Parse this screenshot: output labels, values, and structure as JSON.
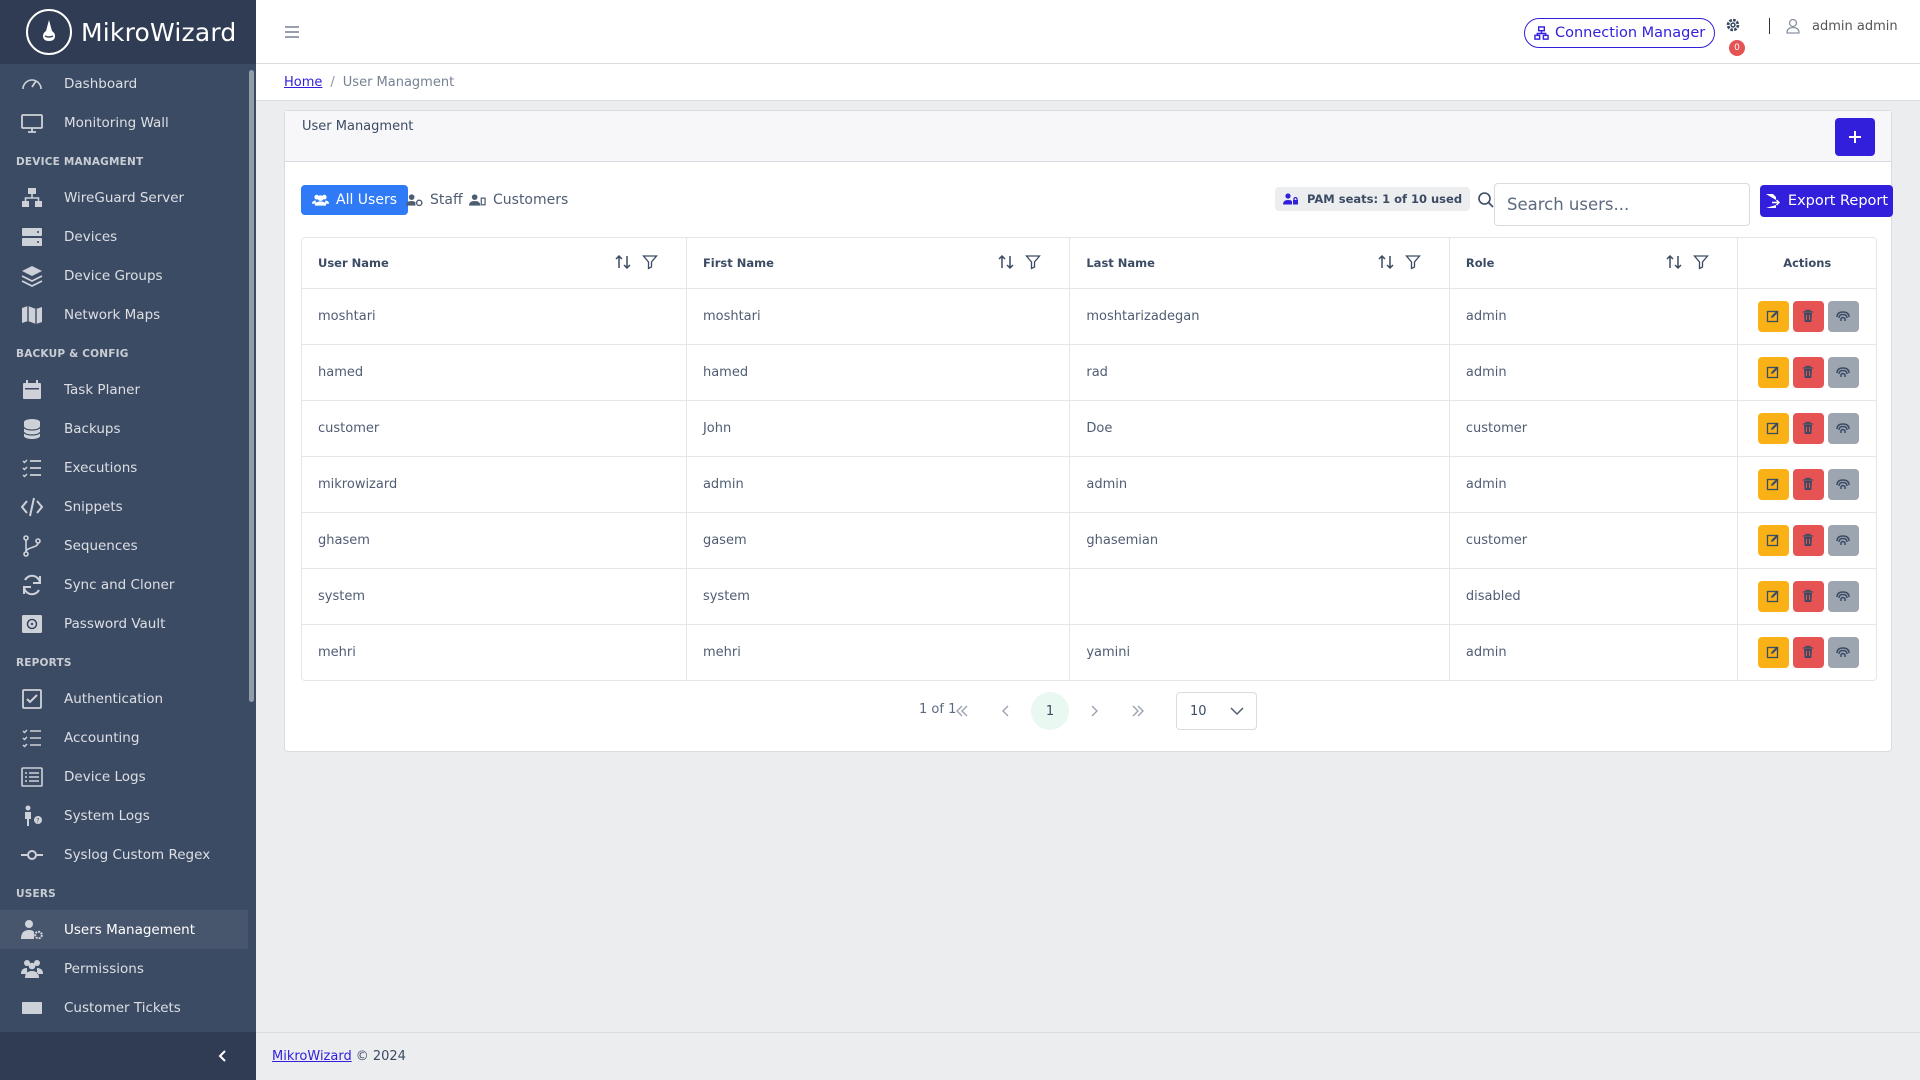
{
  "brand": {
    "name": "MikroWizard"
  },
  "sidebar": {
    "items": [
      {
        "type": "item",
        "label": "Dashboard",
        "icon": "speedometer-icon"
      },
      {
        "type": "item",
        "label": "Monitoring Wall",
        "icon": "monitor-icon"
      },
      {
        "type": "title",
        "label": "DEVICE MANAGMENT"
      },
      {
        "type": "item",
        "label": "WireGuard Server",
        "icon": "network-icon"
      },
      {
        "type": "item",
        "label": "Devices",
        "icon": "server-icon"
      },
      {
        "type": "item",
        "label": "Device Groups",
        "icon": "layers-icon"
      },
      {
        "type": "item",
        "label": "Network Maps",
        "icon": "map-icon"
      },
      {
        "type": "title",
        "label": "BACKUP & CONFIG"
      },
      {
        "type": "item",
        "label": "Task Planer",
        "icon": "calendar-icon"
      },
      {
        "type": "item",
        "label": "Backups",
        "icon": "database-icon"
      },
      {
        "type": "item",
        "label": "Executions",
        "icon": "list-check-icon"
      },
      {
        "type": "item",
        "label": "Snippets",
        "icon": "code-icon"
      },
      {
        "type": "item",
        "label": "Sequences",
        "icon": "branch-icon"
      },
      {
        "type": "item",
        "label": "Sync and Cloner",
        "icon": "sync-icon"
      },
      {
        "type": "item",
        "label": "Password Vault",
        "icon": "vault-icon"
      },
      {
        "type": "title",
        "label": "REPORTS"
      },
      {
        "type": "item",
        "label": "Authentication",
        "icon": "chart-check-icon"
      },
      {
        "type": "item",
        "label": "Accounting",
        "icon": "list-icon"
      },
      {
        "type": "item",
        "label": "Device Logs",
        "icon": "list-rich-icon"
      },
      {
        "type": "item",
        "label": "System Logs",
        "icon": "person-question-icon"
      },
      {
        "type": "item",
        "label": "Syslog Custom Regex",
        "icon": "commit-icon"
      },
      {
        "type": "title",
        "label": "USERS"
      },
      {
        "type": "item",
        "label": "Users Management",
        "icon": "user-gear-icon",
        "active": true
      },
      {
        "type": "item",
        "label": "Permissions",
        "icon": "people-icon"
      },
      {
        "type": "item",
        "label": "Customer Tickets",
        "icon": "ticket-icon"
      }
    ]
  },
  "header": {
    "connection_manager": "Connection Manager",
    "notification_count": "0",
    "user_name": "admin admin"
  },
  "breadcrumb": {
    "home": "Home",
    "current": "User Managment"
  },
  "card": {
    "title": "User Managment"
  },
  "tabs": [
    {
      "label": "All Users",
      "active": true
    },
    {
      "label": "Staff",
      "active": false
    },
    {
      "label": "Customers",
      "active": false
    }
  ],
  "pam": {
    "label": "PAM seats: 1 of 10 used"
  },
  "search": {
    "placeholder": "Search users..."
  },
  "export": {
    "label": "Export Report"
  },
  "table": {
    "columns": [
      "User Name",
      "First Name",
      "Last Name",
      "Role",
      "Actions"
    ],
    "rows": [
      {
        "username": "moshtari",
        "first": "moshtari",
        "last": "moshtarizadegan",
        "role": "admin"
      },
      {
        "username": "hamed",
        "first": "hamed",
        "last": "rad",
        "role": "admin"
      },
      {
        "username": "customer",
        "first": "John",
        "last": "Doe",
        "role": "customer"
      },
      {
        "username": "mikrowizard",
        "first": "admin",
        "last": "admin",
        "role": "admin"
      },
      {
        "username": "ghasem",
        "first": "gasem",
        "last": "ghasemian",
        "role": "customer"
      },
      {
        "username": "system",
        "first": "system",
        "last": "",
        "role": "disabled"
      },
      {
        "username": "mehri",
        "first": "mehri",
        "last": "yamini",
        "role": "admin"
      }
    ]
  },
  "pagination": {
    "report": "1 of 1",
    "current_page": "1",
    "page_size": "10"
  },
  "footer": {
    "link": "MikroWizard",
    "copyright": "© 2024"
  },
  "colors": {
    "sidebar": "#3c4b64",
    "primary": "#321fdb",
    "tab_active": "#2f7af6",
    "warning": "#f9b115",
    "danger": "#e55353"
  }
}
